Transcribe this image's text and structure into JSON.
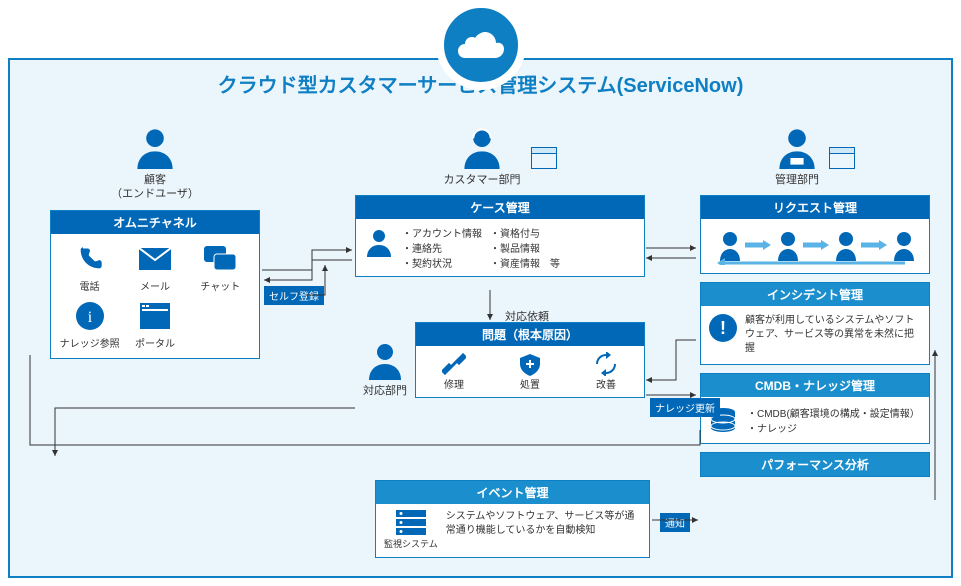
{
  "title": "クラウド型カスタマーサービス管理システム(ServiceNow)",
  "customer": {
    "label": "顧客\n（エンドユーザ）",
    "header": "オムニチャネル",
    "channels": [
      {
        "name": "電話",
        "icon": "phone"
      },
      {
        "name": "メール",
        "icon": "mail"
      },
      {
        "name": "チャット",
        "icon": "chat"
      },
      {
        "name": "ナレッジ参照",
        "icon": "info"
      },
      {
        "name": "ポータル",
        "icon": "portal"
      }
    ]
  },
  "tags": {
    "self_register": "セルフ登録",
    "knowledge_update": "ナレッジ更新",
    "notify": "通知"
  },
  "customer_dept": {
    "label": "カスタマー部門",
    "case": {
      "header": "ケース管理",
      "col1": [
        "・アカウント情報",
        "・連絡先",
        "・契約状況"
      ],
      "col2": [
        "・資格付与",
        "・製品情報",
        "・資産情報　等"
      ]
    },
    "request_label": "対応依頼",
    "response_dept": "対応部門",
    "problem": {
      "header": "問題（根本原因）",
      "items": [
        "修理",
        "処置",
        "改善"
      ]
    }
  },
  "admin": {
    "label": "管理部門",
    "request": {
      "header": "リクエスト管理"
    },
    "incident": {
      "header": "インシデント管理",
      "desc": "顧客が利用しているシステムやソフトウェア、サービス等の異常を未然に把握"
    },
    "cmdb": {
      "header": "CMDB・ナレッジ管理",
      "lines": [
        "・CMDB(顧客環境の構成・設定情報）",
        "・ナレッジ"
      ]
    },
    "perf": {
      "header": "パフォーマンス分析"
    }
  },
  "event": {
    "header": "イベント管理",
    "desc": "システムやソフトウェア、サービス等が通常通り機能しているかを自動検知",
    "monitor_label": "監視システム"
  }
}
